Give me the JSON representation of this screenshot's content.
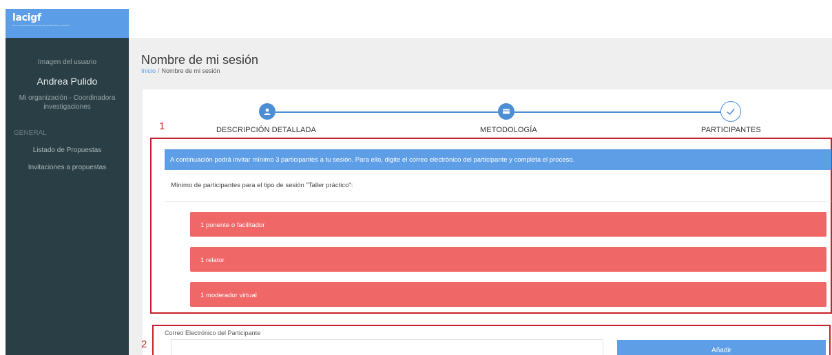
{
  "app": {
    "logo_text": "lacigf",
    "logo_subtext": "Foro de Gobernanza de Internet de América Latina y el Caribe"
  },
  "sidebar": {
    "user_image_label": "Imagen del usuario",
    "user_name": "Andrea Pulido",
    "user_org": "Mi organización - Coordinadora investigaciones",
    "section_label": "GENERAL",
    "items": [
      {
        "label": "Listado de Propuestas"
      },
      {
        "label": "Invitaciones a propuestas"
      }
    ]
  },
  "header": {
    "page_title": "Nombre de mi sesión",
    "breadcrumb": {
      "home": "Inicio",
      "separator": "/",
      "current": "Nombre de mi sesión"
    }
  },
  "stepper": {
    "steps": [
      {
        "label": "DESCRIPCIÓN DETALLADA",
        "icon": "user-icon"
      },
      {
        "label": "METODOLOGÍA",
        "icon": "card-icon"
      },
      {
        "label": "PARTICIPANTES",
        "icon": "check-icon"
      }
    ]
  },
  "annotations": {
    "marker_1": "1",
    "marker_2": "2"
  },
  "participants": {
    "info_banner": "A continuación podrá invitar mínimo 3 participantes a tu sesión. Para ello, digite el correo electrónico del participante y completa el proceso.",
    "minimum_label": "Mínimo de participantes para el tipo de sesión \"Taller práctico\":",
    "roles": [
      {
        "label": "1 ponente o facilitador"
      },
      {
        "label": "1 relator"
      },
      {
        "label": "1 moderador virtual"
      }
    ]
  },
  "form": {
    "email_label": "Correo Electrónico del Participante",
    "email_value": "",
    "add_button": "Añadir"
  },
  "colors": {
    "sidebar_bg": "#2a3f45",
    "accent_blue": "#5e9ee6",
    "role_red": "#f06768",
    "annotation_red": "#c8202a"
  }
}
